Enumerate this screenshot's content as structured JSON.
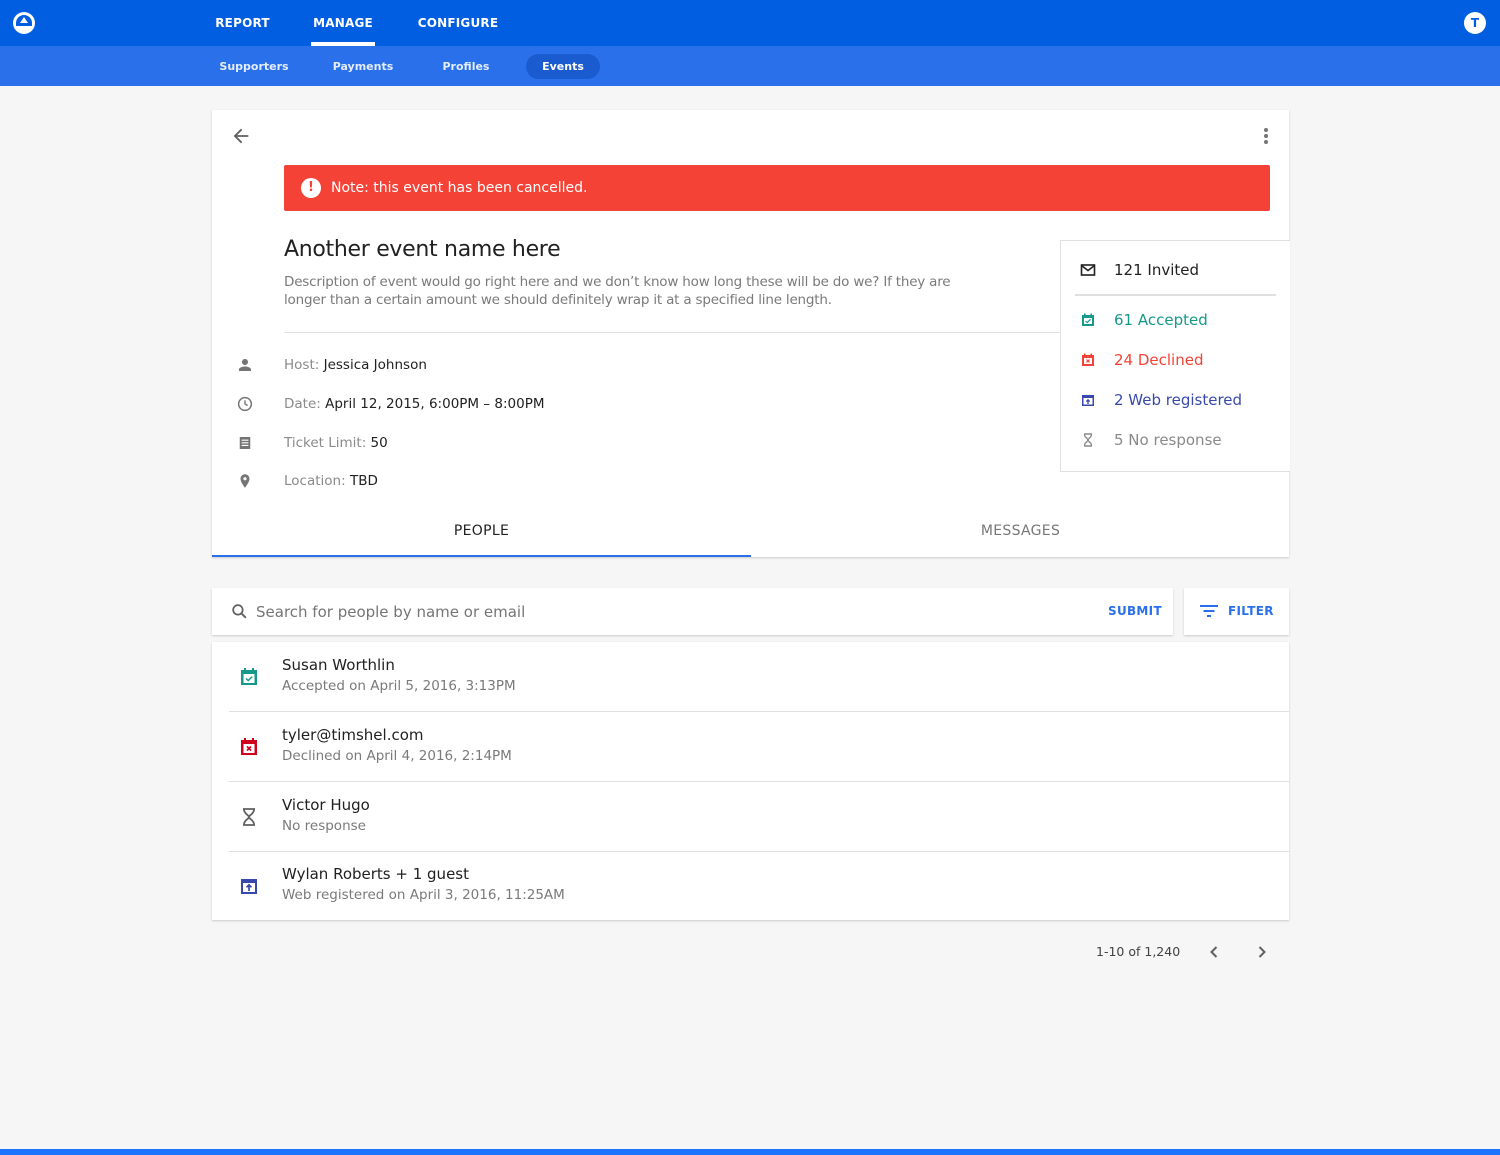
{
  "colors": {
    "primary": "#025ee0",
    "subnav": "#2a70ea",
    "alert": "#f44336",
    "accepted": "#15998a",
    "declined": "#f44336",
    "declined_dark": "#d0021b",
    "web_registered": "#3949ab",
    "no_response": "#8a8a8a",
    "link": "#2a70ea"
  },
  "topbar": {
    "logo": "triangle-logo-icon",
    "nav": [
      {
        "label": "REPORT",
        "active": false
      },
      {
        "label": "MANAGE",
        "active": true
      },
      {
        "label": "CONFIGURE",
        "active": false
      }
    ],
    "avatar_initial": "T"
  },
  "subnav": {
    "items": [
      {
        "label": "Supporters",
        "active": false
      },
      {
        "label": "Payments",
        "active": false
      },
      {
        "label": "Profiles",
        "active": false
      },
      {
        "label": "Events",
        "active": true
      }
    ]
  },
  "event": {
    "back_icon": "arrow-left-icon",
    "more_icon": "more-vertical-icon",
    "alert": {
      "icon": "alert-circle-icon",
      "text": "Note: this event has been cancelled."
    },
    "title": "Another event name here",
    "description": "Description of event would go right here and we don’t know how long these will be do we? If they are longer than a certain amount we should definitely wrap it at a specified line length.",
    "details": [
      {
        "icon": "person-icon",
        "label": "Host:",
        "value": "Jessica Johnson"
      },
      {
        "icon": "clock-icon",
        "label": "Date:",
        "value": "April 12, 2015, 6:00PM – 8:00PM"
      },
      {
        "icon": "ticket-icon",
        "label": "Ticket Limit:",
        "value": "50"
      },
      {
        "icon": "location-pin-icon",
        "label": "Location:",
        "value": "TBD"
      }
    ],
    "stats": [
      {
        "icon": "mail-icon",
        "text": "121 Invited",
        "count": 121,
        "label": "Invited"
      },
      {
        "icon": "calendar-check-icon",
        "text": "61 Accepted",
        "count": 61,
        "label": "Accepted"
      },
      {
        "icon": "calendar-x-icon",
        "text": "24 Declined",
        "count": 24,
        "label": "Declined"
      },
      {
        "icon": "web-registered-icon",
        "text": "2 Web registered",
        "count": 2,
        "label": "Web registered"
      },
      {
        "icon": "hourglass-icon",
        "text": "5 No response",
        "count": 5,
        "label": "No response"
      }
    ],
    "tabs": [
      {
        "label": "PEOPLE",
        "active": true
      },
      {
        "label": "MESSAGES",
        "active": false
      }
    ]
  },
  "search": {
    "placeholder": "Search for people by name or email",
    "value": "",
    "submit_label": "SUBMIT",
    "filter_label": "FILTER"
  },
  "people": [
    {
      "status": "accepted",
      "icon": "calendar-check-icon",
      "name": "Susan Worthlin",
      "detail": "Accepted on April 5, 2016, 3:13PM"
    },
    {
      "status": "declined",
      "icon": "calendar-x-icon",
      "name": "tyler@timshel.com",
      "detail": "Declined on April 4, 2016, 2:14PM"
    },
    {
      "status": "no_response",
      "icon": "hourglass-icon",
      "name": "Victor Hugo",
      "detail": "No response"
    },
    {
      "status": "web_registered",
      "icon": "web-registered-icon",
      "name": "Wylan Roberts + 1 guest",
      "detail": "Web registered on April 3, 2016, 11:25AM"
    }
  ],
  "pagination": {
    "range_text": "1-10 of 1,240",
    "prev_icon": "chevron-left-icon",
    "next_icon": "chevron-right-icon"
  }
}
